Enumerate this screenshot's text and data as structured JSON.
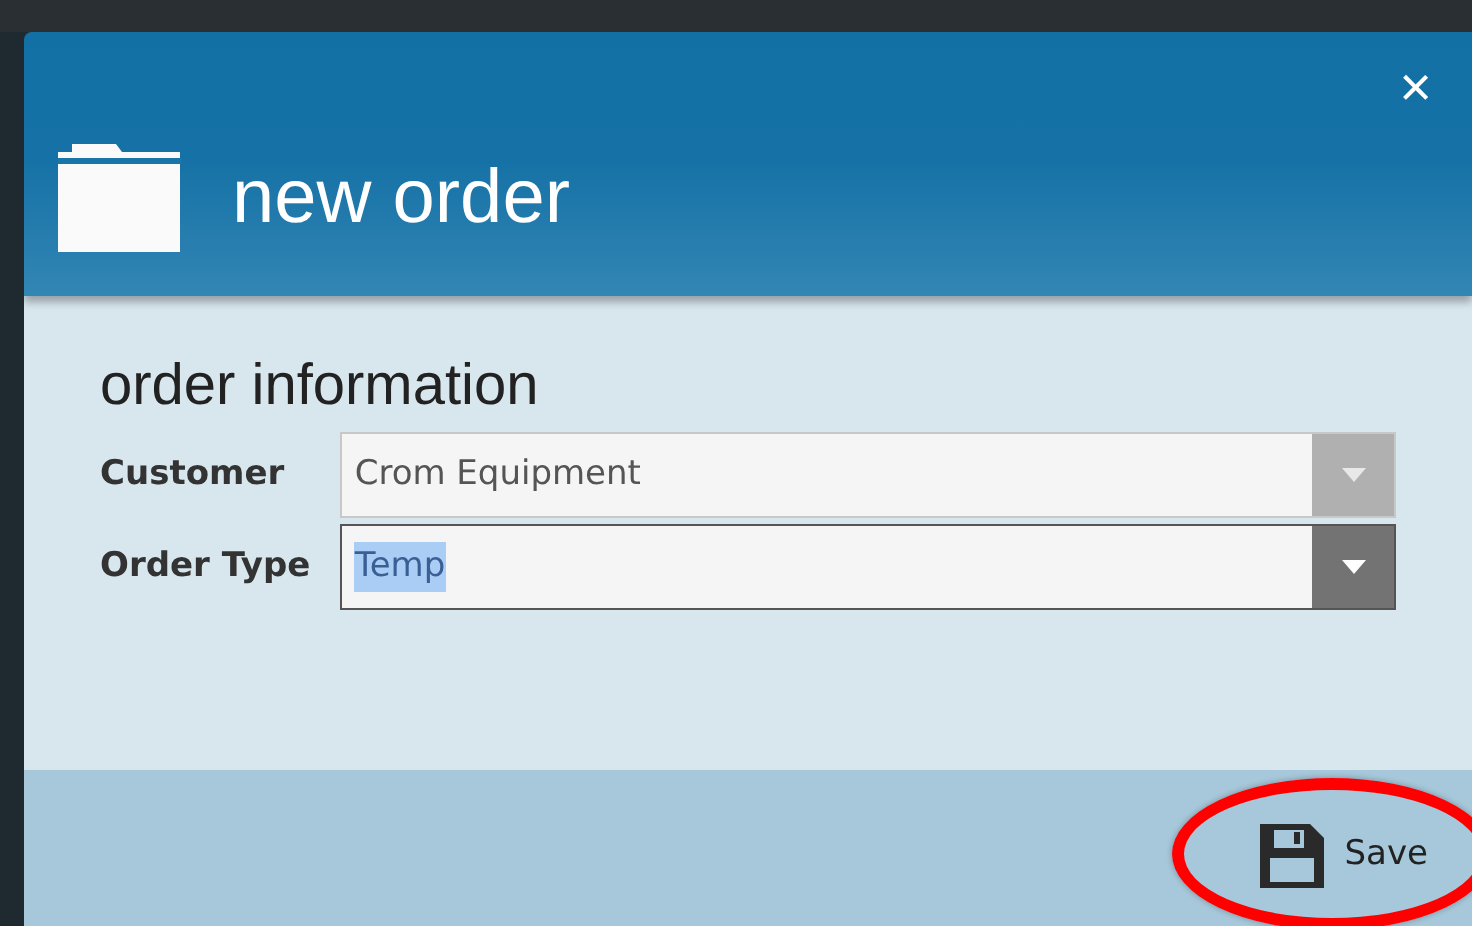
{
  "dialog": {
    "title": "new order",
    "close": "×"
  },
  "section": {
    "title": "order information"
  },
  "fields": [
    {
      "label": "Customer",
      "value": "Crom Equipment",
      "disabled": true,
      "text_selected": false
    },
    {
      "label": "Order Type",
      "value": "Temp",
      "disabled": false,
      "text_selected": true
    }
  ],
  "footer": {
    "save_label": "Save",
    "annotated": true
  }
}
